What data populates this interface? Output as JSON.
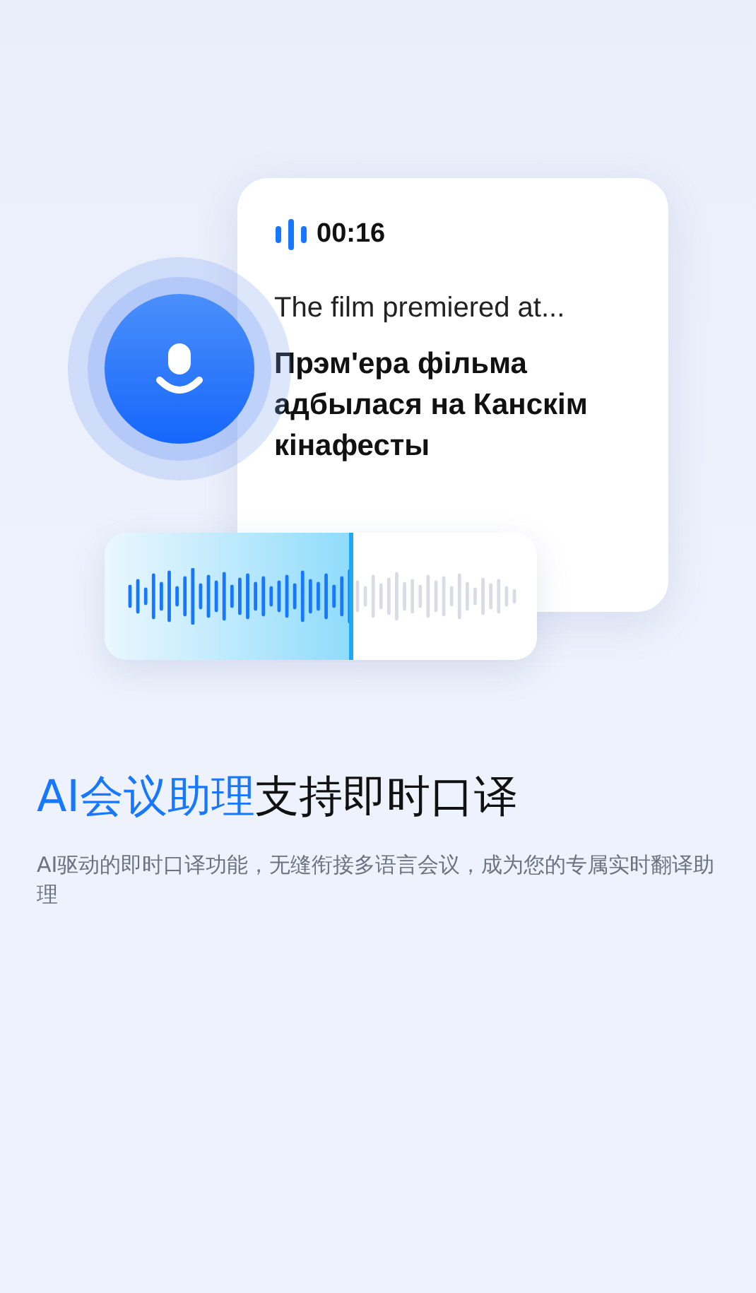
{
  "transcript_card": {
    "timer": "00:16",
    "source_text": "The film premiered at...",
    "translation": "Прэм'ера фільма адбылася на Канскім кінафесты"
  },
  "playback": {
    "level": 0.57
  },
  "headline": {
    "highlight": "AI会议助理",
    "rest": "支持即时口译"
  },
  "description": "AI驱动的即时口译功能，无缝衔接多语言会议，成为您的专属实时翻译助理"
}
